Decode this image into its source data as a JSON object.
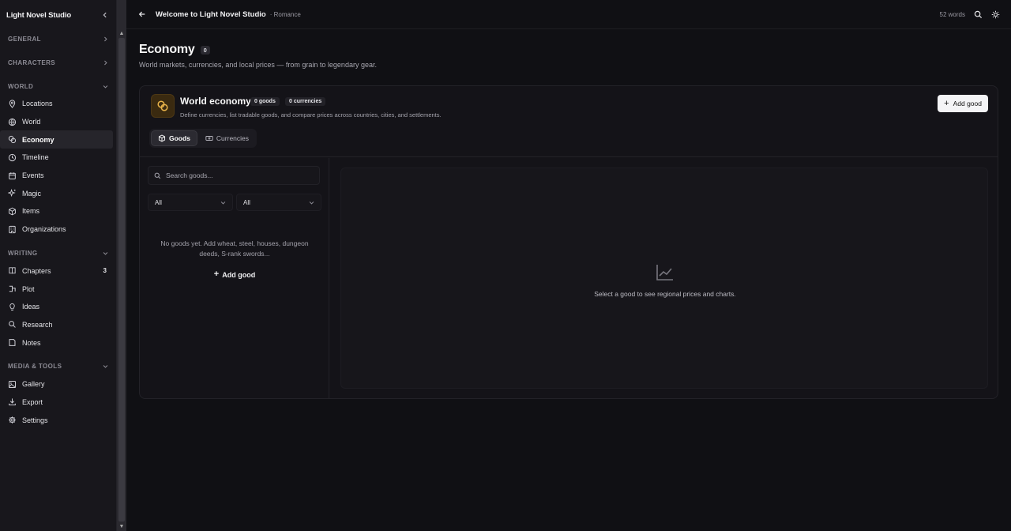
{
  "app": {
    "title": "Light Novel Studio"
  },
  "sidebar": {
    "sections": [
      {
        "label": "GENERAL",
        "items": []
      },
      {
        "label": "CHARACTERS",
        "items": []
      },
      {
        "label": "WORLD",
        "items": [
          {
            "label": "Locations",
            "icon": "map-pin-icon"
          },
          {
            "label": "World",
            "icon": "globe-icon"
          },
          {
            "label": "Economy",
            "icon": "coins-icon",
            "active": true
          },
          {
            "label": "Timeline",
            "icon": "clock-icon"
          },
          {
            "label": "Events",
            "icon": "calendar-icon"
          },
          {
            "label": "Magic",
            "icon": "sparkles-icon"
          },
          {
            "label": "Items",
            "icon": "box-icon"
          },
          {
            "label": "Organizations",
            "icon": "building-icon"
          }
        ]
      },
      {
        "label": "WRITING",
        "items": [
          {
            "label": "Chapters",
            "icon": "book-icon",
            "badge": "3"
          },
          {
            "label": "Plot",
            "icon": "plot-icon"
          },
          {
            "label": "Ideas",
            "icon": "lightbulb-icon"
          },
          {
            "label": "Research",
            "icon": "search-icon"
          },
          {
            "label": "Notes",
            "icon": "note-icon"
          }
        ]
      },
      {
        "label": "MEDIA & TOOLS",
        "items": [
          {
            "label": "Gallery",
            "icon": "image-icon"
          },
          {
            "label": "Export",
            "icon": "download-icon"
          },
          {
            "label": "Settings",
            "icon": "gear-icon"
          }
        ]
      }
    ]
  },
  "topbar": {
    "title": "Welcome to Light Novel Studio",
    "subtitle": "· Romance",
    "words": "52 words"
  },
  "page": {
    "title": "Economy",
    "count": "0",
    "description": "World markets, currencies, and local prices — from grain to legendary gear."
  },
  "economy": {
    "title": "World economy",
    "goods_count": "0 goods",
    "currencies_count": "0 currencies",
    "description": "Define currencies, list tradable goods, and compare prices across countries, cities, and settlements.",
    "add_good_label": "Add good",
    "tabs": [
      {
        "label": "Goods",
        "icon": "cube-icon",
        "active": true
      },
      {
        "label": "Currencies",
        "icon": "banknote-icon"
      }
    ],
    "search_placeholder": "Search goods...",
    "filter1": "All",
    "filter2": "All",
    "empty_text": "No goods yet. Add wheat, steel, houses, dungeon deeds, S-rank swords...",
    "empty_add_label": "Add good",
    "detail_text": "Select a good to see regional prices and charts."
  },
  "colors": {
    "accent_gold": "#e8b34a",
    "bg": "#101014"
  }
}
